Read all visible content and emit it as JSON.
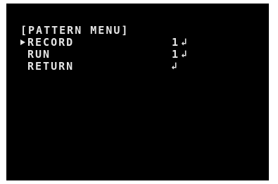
{
  "menu": {
    "title": "[PATTERN MENU]",
    "items": [
      {
        "label": "RECORD",
        "value": "1",
        "selected": true
      },
      {
        "label": "RUN",
        "value": "1",
        "selected": false
      },
      {
        "label": "RETURN",
        "value": "",
        "selected": false
      }
    ],
    "enter_glyph": "↲",
    "text_color": "#e6e6e6",
    "background_color": "#000000",
    "icons": {
      "cursor": "selection-cursor-icon",
      "enter": "enter-icon"
    }
  }
}
